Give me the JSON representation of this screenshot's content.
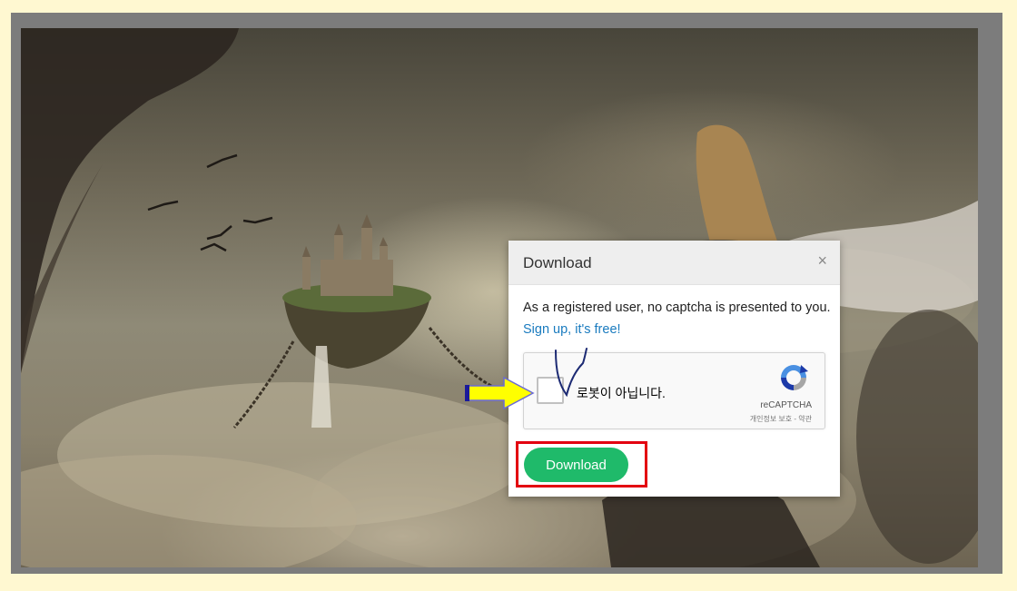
{
  "modal": {
    "title": "Download",
    "close_glyph": "×",
    "message": "As a registered user, no captcha is presented to you.",
    "signup_link": "Sign up, it's free!",
    "download_button": "Download"
  },
  "recaptcha": {
    "label": "로봇이 아닙니다.",
    "brand": "reCAPTCHA",
    "privacy_link": "개인정보 보호",
    "separator": "-",
    "terms_link": "약관",
    "logo_icon": "recaptcha-logo-icon"
  },
  "annotations": {
    "arrow_color": "#ffff00",
    "highlight_color": "#e30010",
    "scribble_color": "#1c2a73"
  },
  "colors": {
    "page_background": "#fff8d1",
    "button": "#1fba6a",
    "link": "#1a7bbf"
  }
}
